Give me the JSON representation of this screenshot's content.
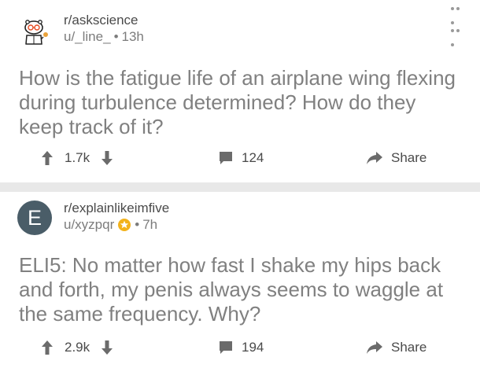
{
  "posts": [
    {
      "subreddit": "r/askscience",
      "user": "u/_line_",
      "time": "13h",
      "title": "How is the fatigue life of an airplane wing flexing during turbulence determined? How do they keep track of it?",
      "votes": "1.7k",
      "comments": "124",
      "share_label": "Share",
      "avatar_icon": "askscience-snoo-icon"
    },
    {
      "subreddit": "r/explainlikeimfive",
      "user": "u/xyzpqr",
      "time": "7h",
      "title": "ELI5: No matter how fast I shake my hips back and forth, my penis always seems to waggle at the same frequency. Why?",
      "votes": "2.9k",
      "comments": "194",
      "share_label": "Share",
      "avatar_letter": "E",
      "badge_icon": "gold-award-icon"
    }
  ],
  "separator": "•",
  "colors": {
    "divider": "#e8e8e8",
    "avatar_bg": "#4a5d68",
    "gold": "#f2b21b"
  }
}
